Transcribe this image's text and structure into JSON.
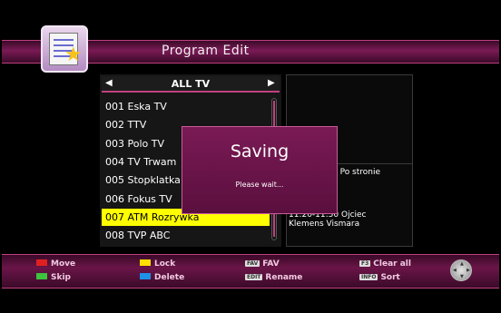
{
  "header": {
    "title": "Program Edit"
  },
  "list": {
    "group": "ALL TV",
    "channels": [
      "001 Eska TV",
      "002 TTV",
      "003 Polo TV",
      "004 TV Trwam",
      "005 Stopklatka",
      "006 Fokus TV",
      "007 ATM Rozrywka",
      "008 TVP ABC"
    ],
    "selected_index": 6
  },
  "epg": {
    "line1": "0  Po stronie",
    "line2a": "11:20-11:50  Ojciec",
    "line2b": "Klemens Vismara"
  },
  "dialog": {
    "title": "Saving",
    "message": "Please wait..."
  },
  "footer": {
    "move": "Move",
    "skip": "Skip",
    "lock": "Lock",
    "delete": "Delete",
    "fav_key": "FAV",
    "fav": "FAV",
    "edit_key": "EDIT",
    "rename": "Rename",
    "f3_key": "F3",
    "clear_all": "Clear all",
    "info_key": "INFO",
    "sort": "Sort"
  },
  "colors": {
    "accent": "#c0407f",
    "selected": "#ffff00",
    "red": "#e02020",
    "green": "#3cc43c",
    "yellow": "#ffe000",
    "blue": "#1e90e8"
  }
}
